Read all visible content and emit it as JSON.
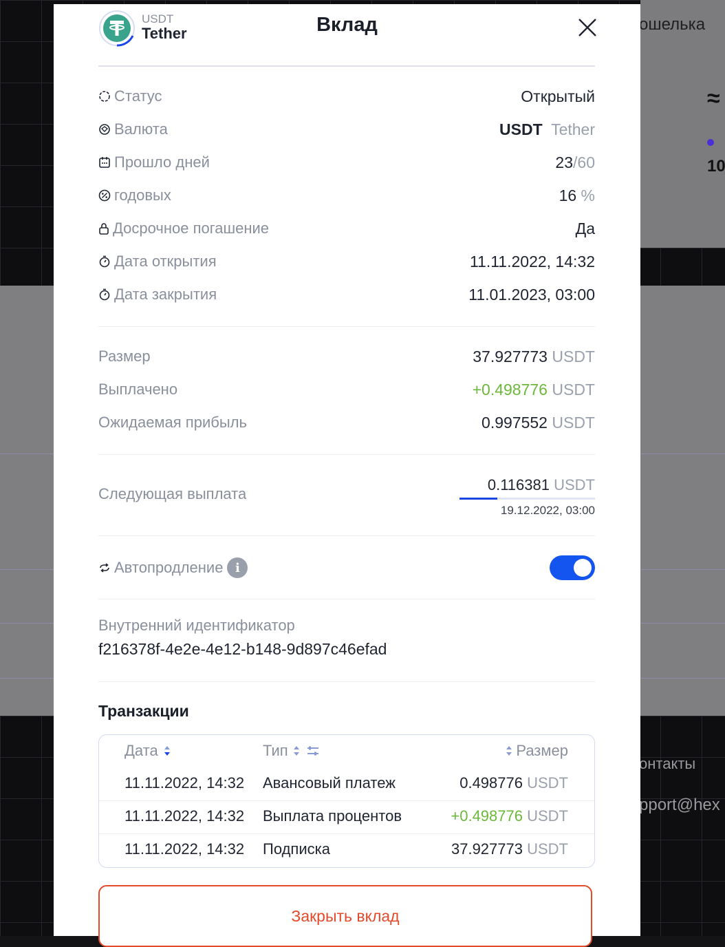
{
  "background": {
    "wallet_fragment": "ошелька",
    "approx_symbol": "≈",
    "number_fragment": "10",
    "contacts_fragment": "онтакты",
    "email_fragment": "pport@hex"
  },
  "modal": {
    "coin_symbol": "USDT",
    "coin_name": "Tether",
    "title": "Вклад",
    "details": {
      "status_label": "Статус",
      "status_value": "Открытый",
      "currency_label": "Валюта",
      "currency_code": "USDT",
      "currency_name": "Tether",
      "days_label": "Прошло дней",
      "days_elapsed": "23",
      "days_total": "/60",
      "annual_label": "годовых",
      "annual_value": "16",
      "annual_unit": "%",
      "early_label": "Досрочное погашение",
      "early_value": "Да",
      "open_date_label": "Дата открытия",
      "open_date_value": "11.11.2022, 14:32",
      "close_date_label": "Дата закрытия",
      "close_date_value": "11.01.2023, 03:00"
    },
    "amounts": {
      "size_label": "Размер",
      "size_value": "37.927773",
      "paid_label": "Выплачено",
      "paid_value": "+0.498776",
      "expected_label": "Ожидаемая прибыль",
      "expected_value": "0.997552",
      "unit": "USDT"
    },
    "next_payment": {
      "label": "Следующая выплата",
      "value": "0.116381",
      "unit": "USDT",
      "date": "19.12.2022, 03:00",
      "progress_fraction": 0.28
    },
    "autorenew": {
      "label": "Автопродление",
      "info": "i",
      "enabled": true
    },
    "internal_id": {
      "label": "Внутренний идентификатор",
      "value": "f216378f-4e2e-4e12-b148-9d897c46efad"
    },
    "transactions": {
      "title": "Транзакции",
      "col_date": "Дата",
      "col_type": "Тип",
      "col_amount": "Размер",
      "rows": [
        {
          "date": "11.11.2022, 14:32",
          "type": "Авансовый платеж",
          "amount": "0.498776",
          "unit": "USDT"
        },
        {
          "date": "11.11.2022, 14:32",
          "type": "Выплата процентов",
          "amount": "+0.498776",
          "unit": "USDT"
        },
        {
          "date": "11.11.2022, 14:32",
          "type": "Подписка",
          "amount": "37.927773",
          "unit": "USDT"
        }
      ]
    },
    "close_button": "Закрыть вклад"
  },
  "colors": {
    "accent_blue": "#1455f0",
    "positive_green": "#6bb83a",
    "danger_red": "#e24a2a",
    "tether_green": "#3aa38b"
  }
}
